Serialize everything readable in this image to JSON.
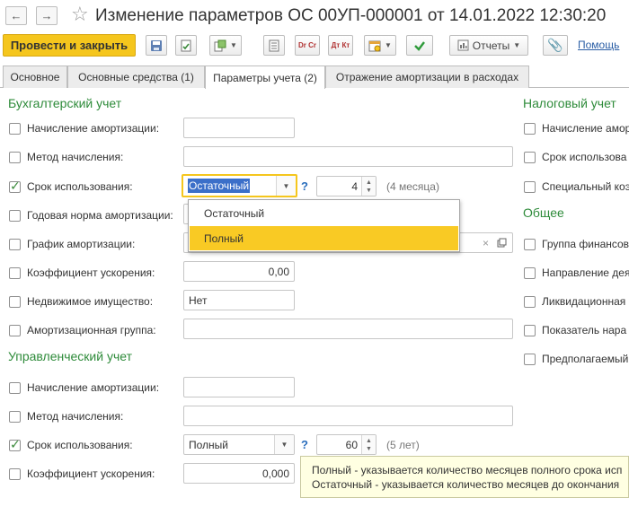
{
  "window": {
    "title": "Изменение параметров ОС 00УП-000001 от 14.01.2022 12:30:20"
  },
  "toolbar": {
    "post_label": "Провести и закрыть",
    "dt_cr_label": "Dr Cr",
    "dt_kt_label": "Дт Кт",
    "reports_label": "Отчеты",
    "help_label": "Помощь"
  },
  "tabs": [
    {
      "label": "Основное"
    },
    {
      "label": "Основные средства (1)"
    },
    {
      "label": "Параметры учета (2)"
    },
    {
      "label": "Отражение амортизации в расходах"
    }
  ],
  "accounting": {
    "title": "Бухгалтерский учет",
    "rows": [
      {
        "label": "Начисление амортизации:",
        "checked": false,
        "value": ""
      },
      {
        "label": "Метод начисления:",
        "checked": false,
        "value": ""
      },
      {
        "label": "Срок использования:",
        "checked": true,
        "value": "Остаточный",
        "number": "4",
        "hint": "(4 месяца)"
      },
      {
        "label": "Годовая норма амортизации:",
        "checked": false,
        "value": ""
      },
      {
        "label": "График амортизации:",
        "checked": false,
        "value": ""
      },
      {
        "label": "Коэффициент ускорения:",
        "checked": false,
        "value": "0,00"
      },
      {
        "label": "Недвижимое имущество:",
        "checked": false,
        "value": "Нет"
      },
      {
        "label": "Амортизационная группа:",
        "checked": false,
        "value": ""
      }
    ]
  },
  "management": {
    "title": "Управленческий учет",
    "rows": [
      {
        "label": "Начисление амортизации:",
        "checked": false,
        "value": ""
      },
      {
        "label": "Метод начисления:",
        "checked": false,
        "value": ""
      },
      {
        "label": "Срок использования:",
        "checked": true,
        "value": "Полный",
        "number": "60",
        "hint": "(5 лет)"
      },
      {
        "label": "Коэффициент ускорения:",
        "checked": false,
        "value": "0,000"
      }
    ]
  },
  "tax": {
    "title": "Налоговый учет",
    "rows": [
      {
        "label": "Начисление амор",
        "checked": false
      },
      {
        "label": "Срок использова",
        "checked": false
      },
      {
        "label": "Специальный коэ",
        "checked": false
      }
    ]
  },
  "general": {
    "title": "Общее",
    "rows": [
      {
        "label": "Группа финансов",
        "checked": false
      },
      {
        "label": "Направление дея",
        "checked": false
      },
      {
        "label": "Ликвидационная",
        "checked": false
      },
      {
        "label": "Показатель нара",
        "checked": false
      },
      {
        "label": "Предполагаемый",
        "checked": false
      }
    ]
  },
  "dropdown": {
    "options": [
      {
        "label": "Остаточный",
        "highlighted": false
      },
      {
        "label": "Полный",
        "highlighted": true
      }
    ]
  },
  "qmark": "?",
  "tooltip": {
    "line1": "Полный - указывается количество месяцев полного срока исп",
    "line2": "Остаточный - указывается количество месяцев до окончания"
  },
  "colors": {
    "accent_yellow": "#f5c61d",
    "section_green": "#2e8b3a",
    "link_blue": "#2a5ea5"
  }
}
